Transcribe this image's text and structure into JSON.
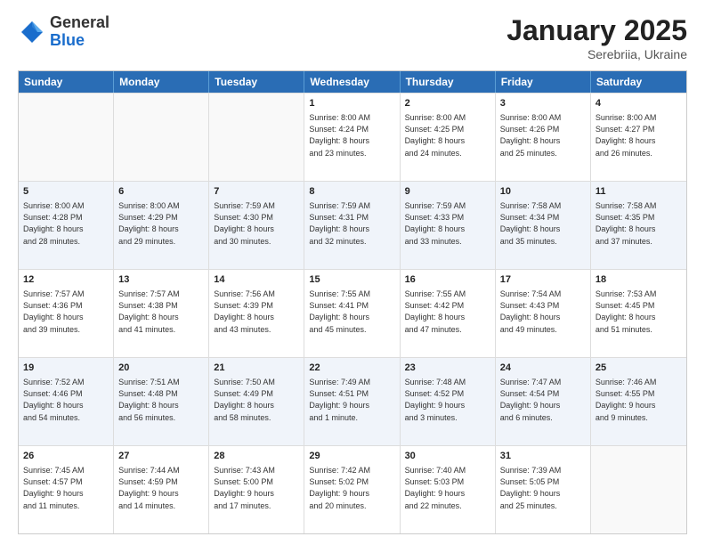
{
  "logo": {
    "general": "General",
    "blue": "Blue"
  },
  "header": {
    "month": "January 2025",
    "location": "Serebriia, Ukraine"
  },
  "weekdays": [
    "Sunday",
    "Monday",
    "Tuesday",
    "Wednesday",
    "Thursday",
    "Friday",
    "Saturday"
  ],
  "rows": [
    [
      {
        "day": "",
        "info": "",
        "empty": true
      },
      {
        "day": "",
        "info": "",
        "empty": true
      },
      {
        "day": "",
        "info": "",
        "empty": true
      },
      {
        "day": "1",
        "info": "Sunrise: 8:00 AM\nSunset: 4:24 PM\nDaylight: 8 hours\nand 23 minutes.",
        "empty": false
      },
      {
        "day": "2",
        "info": "Sunrise: 8:00 AM\nSunset: 4:25 PM\nDaylight: 8 hours\nand 24 minutes.",
        "empty": false
      },
      {
        "day": "3",
        "info": "Sunrise: 8:00 AM\nSunset: 4:26 PM\nDaylight: 8 hours\nand 25 minutes.",
        "empty": false
      },
      {
        "day": "4",
        "info": "Sunrise: 8:00 AM\nSunset: 4:27 PM\nDaylight: 8 hours\nand 26 minutes.",
        "empty": false
      }
    ],
    [
      {
        "day": "5",
        "info": "Sunrise: 8:00 AM\nSunset: 4:28 PM\nDaylight: 8 hours\nand 28 minutes.",
        "empty": false
      },
      {
        "day": "6",
        "info": "Sunrise: 8:00 AM\nSunset: 4:29 PM\nDaylight: 8 hours\nand 29 minutes.",
        "empty": false
      },
      {
        "day": "7",
        "info": "Sunrise: 7:59 AM\nSunset: 4:30 PM\nDaylight: 8 hours\nand 30 minutes.",
        "empty": false
      },
      {
        "day": "8",
        "info": "Sunrise: 7:59 AM\nSunset: 4:31 PM\nDaylight: 8 hours\nand 32 minutes.",
        "empty": false
      },
      {
        "day": "9",
        "info": "Sunrise: 7:59 AM\nSunset: 4:33 PM\nDaylight: 8 hours\nand 33 minutes.",
        "empty": false
      },
      {
        "day": "10",
        "info": "Sunrise: 7:58 AM\nSunset: 4:34 PM\nDaylight: 8 hours\nand 35 minutes.",
        "empty": false
      },
      {
        "day": "11",
        "info": "Sunrise: 7:58 AM\nSunset: 4:35 PM\nDaylight: 8 hours\nand 37 minutes.",
        "empty": false
      }
    ],
    [
      {
        "day": "12",
        "info": "Sunrise: 7:57 AM\nSunset: 4:36 PM\nDaylight: 8 hours\nand 39 minutes.",
        "empty": false
      },
      {
        "day": "13",
        "info": "Sunrise: 7:57 AM\nSunset: 4:38 PM\nDaylight: 8 hours\nand 41 minutes.",
        "empty": false
      },
      {
        "day": "14",
        "info": "Sunrise: 7:56 AM\nSunset: 4:39 PM\nDaylight: 8 hours\nand 43 minutes.",
        "empty": false
      },
      {
        "day": "15",
        "info": "Sunrise: 7:55 AM\nSunset: 4:41 PM\nDaylight: 8 hours\nand 45 minutes.",
        "empty": false
      },
      {
        "day": "16",
        "info": "Sunrise: 7:55 AM\nSunset: 4:42 PM\nDaylight: 8 hours\nand 47 minutes.",
        "empty": false
      },
      {
        "day": "17",
        "info": "Sunrise: 7:54 AM\nSunset: 4:43 PM\nDaylight: 8 hours\nand 49 minutes.",
        "empty": false
      },
      {
        "day": "18",
        "info": "Sunrise: 7:53 AM\nSunset: 4:45 PM\nDaylight: 8 hours\nand 51 minutes.",
        "empty": false
      }
    ],
    [
      {
        "day": "19",
        "info": "Sunrise: 7:52 AM\nSunset: 4:46 PM\nDaylight: 8 hours\nand 54 minutes.",
        "empty": false
      },
      {
        "day": "20",
        "info": "Sunrise: 7:51 AM\nSunset: 4:48 PM\nDaylight: 8 hours\nand 56 minutes.",
        "empty": false
      },
      {
        "day": "21",
        "info": "Sunrise: 7:50 AM\nSunset: 4:49 PM\nDaylight: 8 hours\nand 58 minutes.",
        "empty": false
      },
      {
        "day": "22",
        "info": "Sunrise: 7:49 AM\nSunset: 4:51 PM\nDaylight: 9 hours\nand 1 minute.",
        "empty": false
      },
      {
        "day": "23",
        "info": "Sunrise: 7:48 AM\nSunset: 4:52 PM\nDaylight: 9 hours\nand 3 minutes.",
        "empty": false
      },
      {
        "day": "24",
        "info": "Sunrise: 7:47 AM\nSunset: 4:54 PM\nDaylight: 9 hours\nand 6 minutes.",
        "empty": false
      },
      {
        "day": "25",
        "info": "Sunrise: 7:46 AM\nSunset: 4:55 PM\nDaylight: 9 hours\nand 9 minutes.",
        "empty": false
      }
    ],
    [
      {
        "day": "26",
        "info": "Sunrise: 7:45 AM\nSunset: 4:57 PM\nDaylight: 9 hours\nand 11 minutes.",
        "empty": false
      },
      {
        "day": "27",
        "info": "Sunrise: 7:44 AM\nSunset: 4:59 PM\nDaylight: 9 hours\nand 14 minutes.",
        "empty": false
      },
      {
        "day": "28",
        "info": "Sunrise: 7:43 AM\nSunset: 5:00 PM\nDaylight: 9 hours\nand 17 minutes.",
        "empty": false
      },
      {
        "day": "29",
        "info": "Sunrise: 7:42 AM\nSunset: 5:02 PM\nDaylight: 9 hours\nand 20 minutes.",
        "empty": false
      },
      {
        "day": "30",
        "info": "Sunrise: 7:40 AM\nSunset: 5:03 PM\nDaylight: 9 hours\nand 22 minutes.",
        "empty": false
      },
      {
        "day": "31",
        "info": "Sunrise: 7:39 AM\nSunset: 5:05 PM\nDaylight: 9 hours\nand 25 minutes.",
        "empty": false
      },
      {
        "day": "",
        "info": "",
        "empty": true
      }
    ]
  ]
}
